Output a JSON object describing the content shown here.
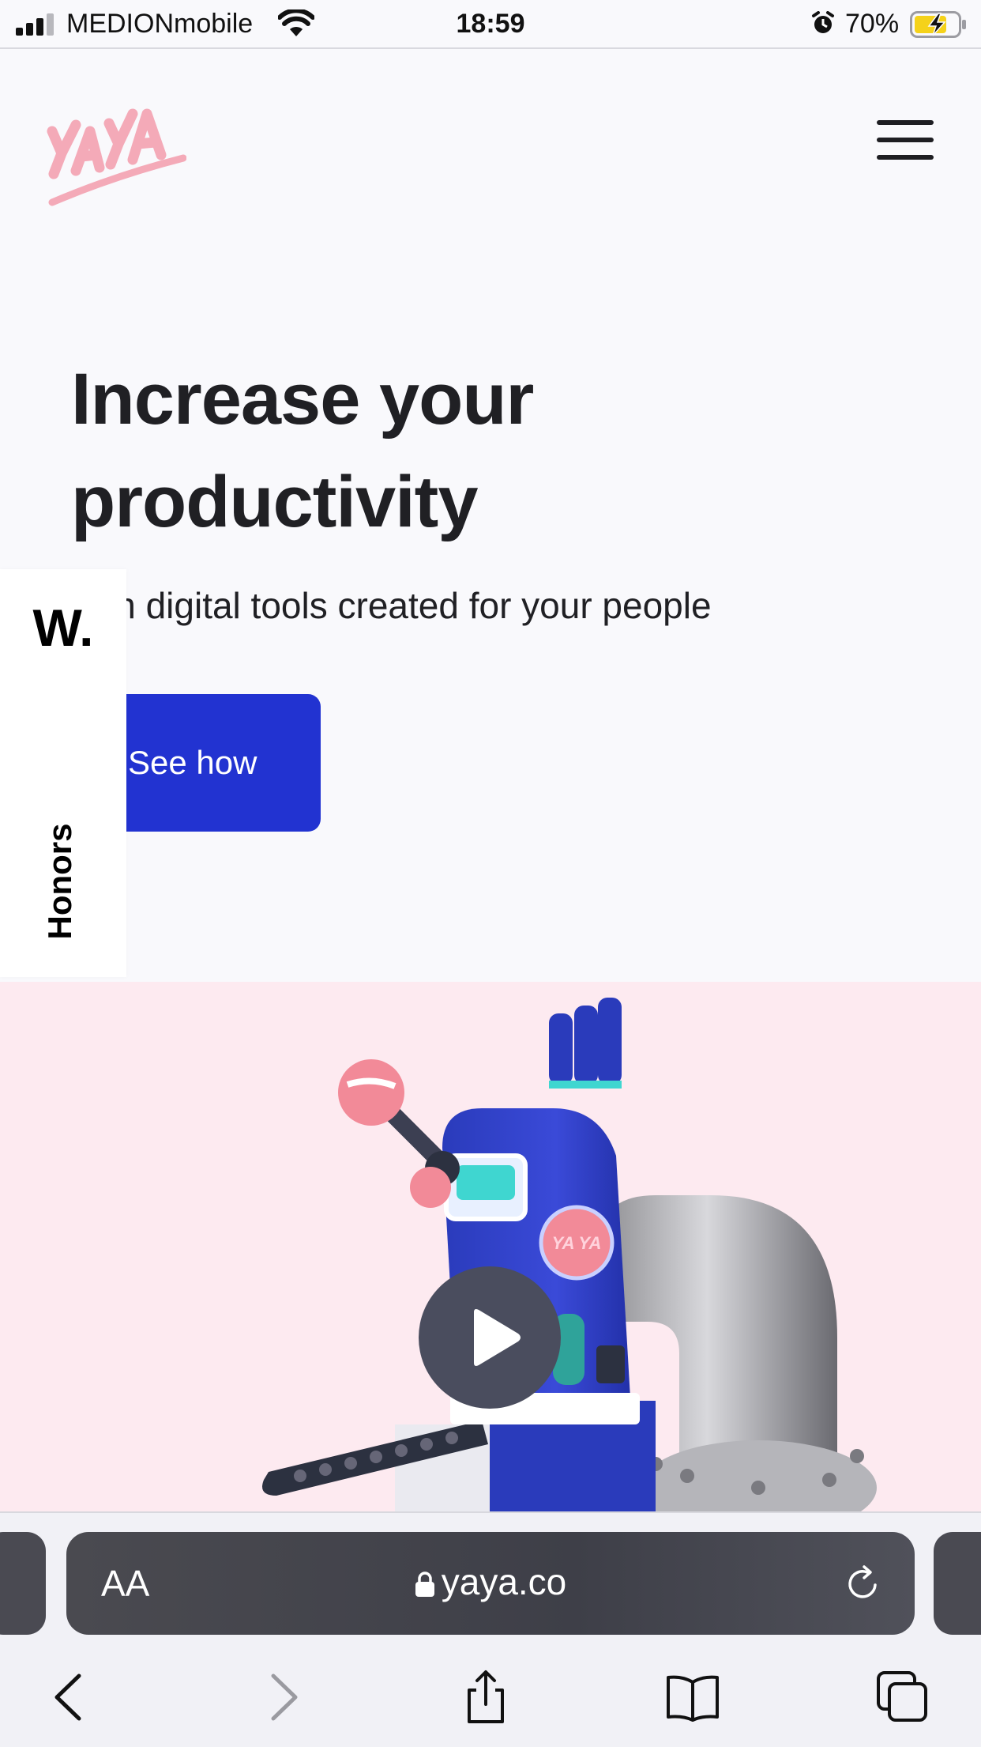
{
  "status_bar": {
    "carrier": "MEDIONmobile",
    "time": "18:59",
    "battery_percent": "70%",
    "icons": [
      "signal-icon",
      "wifi-icon",
      "alarm-icon",
      "battery-charging-icon"
    ]
  },
  "header": {
    "logo_text": "YA YA",
    "logo_color": "#f4aab8",
    "menu_icon": "hamburger-menu-icon"
  },
  "hero": {
    "title_line1": "Increase your",
    "title_line2": "productivity",
    "subtitle": "with digital tools created for your people",
    "cta_label": "See how",
    "cta_color": "#2233d1"
  },
  "honors_tab": {
    "mark": "W.",
    "label": "Honors"
  },
  "video": {
    "background": "#fdeaf0",
    "play_icon": "play-icon",
    "machine_badge": "YA YA"
  },
  "safari": {
    "text_size_label": "AA",
    "url": "yaya.co",
    "icons": [
      "lock-icon",
      "reload-icon",
      "back-icon",
      "forward-icon",
      "share-icon",
      "bookmarks-icon",
      "tabs-icon"
    ]
  }
}
